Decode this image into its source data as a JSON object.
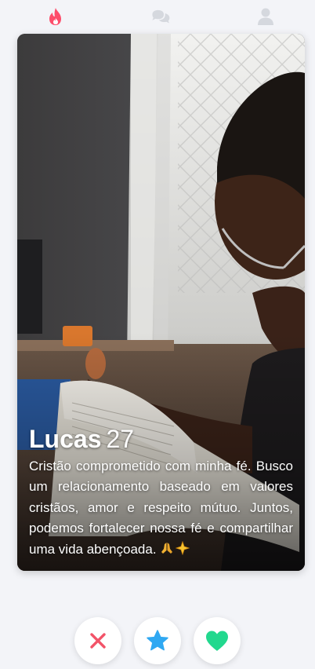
{
  "nav": {
    "items": [
      {
        "icon": "flame-icon",
        "active": true,
        "color": "#fd4d6b"
      },
      {
        "icon": "chat-bubbles-icon",
        "active": false,
        "color": "#d5d8de"
      },
      {
        "icon": "user-icon",
        "active": false,
        "color": "#d5d8de"
      }
    ]
  },
  "profile": {
    "name": "Lucas",
    "age": "27",
    "bio": "Cristão comprometido com minha fé. Busco um relacionamento baseado em valores cristãos, amor e respeito mútuo. Juntos, podemos fortalecer nossa fé e compartilhar uma vida abençoada.",
    "bio_emojis": [
      "praying-hands-icon",
      "sparkle-star-icon"
    ]
  },
  "actions": {
    "nope": {
      "icon": "close-icon",
      "color": "#f25368"
    },
    "super_like": {
      "icon": "star-icon",
      "color": "#2fa8f2"
    },
    "like": {
      "icon": "heart-icon",
      "color": "#22d88e"
    }
  }
}
